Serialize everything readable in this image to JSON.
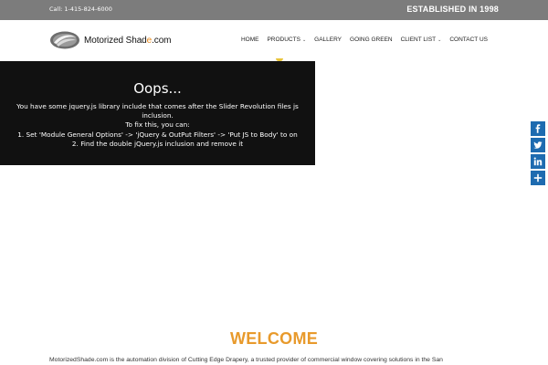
{
  "topbar": {
    "call_text": "Call: 1-415-824-6000",
    "established": "ESTABLISHED IN 1998"
  },
  "logo": {
    "text_before": "Motorized Shad",
    "text_accent": "e",
    "text_after": ".com"
  },
  "nav": {
    "items": [
      {
        "label": "HOME",
        "dropdown": false
      },
      {
        "label": "PRODUCTS",
        "dropdown": true
      },
      {
        "label": "GALLERY",
        "dropdown": false
      },
      {
        "label": "GOING GREEN",
        "dropdown": false
      },
      {
        "label": "CLIENT LIST",
        "dropdown": true
      },
      {
        "label": "CONTACT US",
        "dropdown": false
      }
    ]
  },
  "error": {
    "title": "Oops...",
    "line1": "You have some jquery.js library include that comes after the Slider Revolution files js",
    "line2": "inclusion.",
    "line3": "To fix this, you can:",
    "line4": "1. Set 'Module General Options' -> 'jQuery & OutPut Filters' -> 'Put JS to Body' to on",
    "line5": "2. Find the double jQuery.js inclusion and remove it"
  },
  "social": {
    "items": [
      "facebook-icon",
      "twitter-icon",
      "linkedin-icon",
      "share-icon"
    ]
  },
  "welcome": {
    "heading": "WELCOME",
    "intro": "MotorizedShade.com is the automation division of Cutting Edge Drapery, a trusted provider of commercial window covering solutions in the San"
  },
  "colors": {
    "topbar_bg": "#7c7c7c",
    "accent_orange": "#e89a2c",
    "error_bg": "#111111",
    "social_blue": "#1e6bb0"
  }
}
